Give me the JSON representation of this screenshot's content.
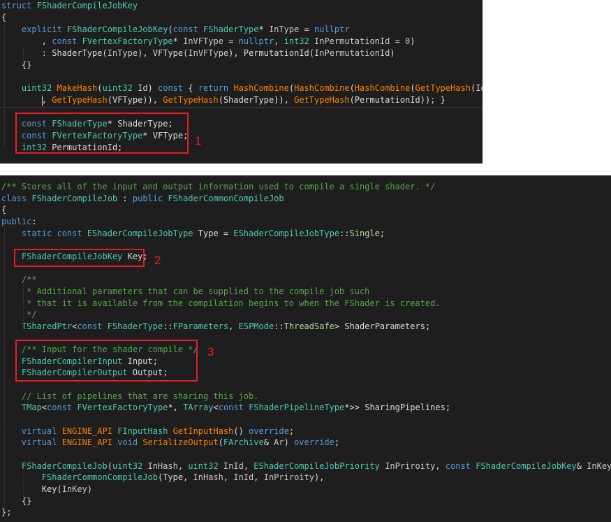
{
  "panel1": {
    "lines": [
      [
        {
          "t": "struct ",
          "c": "kw"
        },
        {
          "t": "FShaderCompileJobKey",
          "c": "ty"
        }
      ],
      [
        {
          "t": "{",
          "c": "pn"
        }
      ],
      [
        {
          "t": "    explicit ",
          "c": "kw"
        },
        {
          "t": "FShaderCompileJobKey",
          "c": "ty"
        },
        {
          "t": "(",
          "c": "pn"
        },
        {
          "t": "const ",
          "c": "kw"
        },
        {
          "t": "FShaderType",
          "c": "ty"
        },
        {
          "t": "* ",
          "c": "pn"
        },
        {
          "t": "InType",
          "c": "pm"
        },
        {
          "t": " = ",
          "c": "pn"
        },
        {
          "t": "nullptr",
          "c": "kw"
        }
      ],
      [
        {
          "t": "        , ",
          "c": "pn"
        },
        {
          "t": "const ",
          "c": "kw"
        },
        {
          "t": "FVertexFactoryType",
          "c": "ty"
        },
        {
          "t": "* ",
          "c": "pn"
        },
        {
          "t": "InVFType",
          "c": "pm"
        },
        {
          "t": " = ",
          "c": "pn"
        },
        {
          "t": "nullptr",
          "c": "kw"
        },
        {
          "t": ", ",
          "c": "pn"
        },
        {
          "t": "int32 ",
          "c": "ty"
        },
        {
          "t": "InPermutationId",
          "c": "pm"
        },
        {
          "t": " = ",
          "c": "pn"
        },
        {
          "t": "0",
          "c": "num"
        },
        {
          "t": ")",
          "c": "pn"
        }
      ],
      [
        {
          "t": "        : ",
          "c": "pn"
        },
        {
          "t": "ShaderType",
          "c": "pn"
        },
        {
          "t": "(",
          "c": "pn"
        },
        {
          "t": "InType",
          "c": "pm"
        },
        {
          "t": "), ",
          "c": "pn"
        },
        {
          "t": "VFType",
          "c": "pn"
        },
        {
          "t": "(",
          "c": "pn"
        },
        {
          "t": "InVFType",
          "c": "pm"
        },
        {
          "t": "), ",
          "c": "pn"
        },
        {
          "t": "PermutationId",
          "c": "pn"
        },
        {
          "t": "(",
          "c": "pn"
        },
        {
          "t": "InPermutationId",
          "c": "pm"
        },
        {
          "t": ")",
          "c": "pn"
        }
      ],
      [
        {
          "t": "    {}",
          "c": "pn"
        }
      ],
      [
        {
          "t": "",
          "c": "pn"
        }
      ],
      [
        {
          "t": "    uint32 ",
          "c": "ty"
        },
        {
          "t": "MakeHash",
          "c": "ft"
        },
        {
          "t": "(",
          "c": "pn"
        },
        {
          "t": "uint32 ",
          "c": "ty"
        },
        {
          "t": "Id",
          "c": "pm"
        },
        {
          "t": ") ",
          "c": "pn"
        },
        {
          "t": "const ",
          "c": "kw"
        },
        {
          "t": "{ ",
          "c": "pn"
        },
        {
          "t": "return ",
          "c": "kw"
        },
        {
          "t": "HashCombine",
          "c": "ft"
        },
        {
          "t": "(",
          "c": "pn"
        },
        {
          "t": "HashCombine",
          "c": "ft"
        },
        {
          "t": "(",
          "c": "pn"
        },
        {
          "t": "HashCombine",
          "c": "ft"
        },
        {
          "t": "(",
          "c": "pn"
        },
        {
          "t": "GetTypeHash",
          "c": "ft"
        },
        {
          "t": "(",
          "c": "pn"
        },
        {
          "t": "Id",
          "c": "pm"
        },
        {
          "t": ")",
          "c": "pn"
        }
      ],
      [
        {
          "t": "        , ",
          "c": "pn"
        },
        {
          "t": "GetTypeHash",
          "c": "ft"
        },
        {
          "t": "(",
          "c": "pn"
        },
        {
          "t": "VFType",
          "c": "pn"
        },
        {
          "t": ")), ",
          "c": "pn"
        },
        {
          "t": "GetTypeHash",
          "c": "ft"
        },
        {
          "t": "(",
          "c": "pn"
        },
        {
          "t": "ShaderType",
          "c": "pn"
        },
        {
          "t": ")), ",
          "c": "pn"
        },
        {
          "t": "GetTypeHash",
          "c": "ft"
        },
        {
          "t": "(",
          "c": "pn"
        },
        {
          "t": "PermutationId",
          "c": "pn"
        },
        {
          "t": ")); }",
          "c": "pn"
        }
      ],
      [
        {
          "t": "",
          "c": "pn"
        }
      ],
      [
        {
          "t": "    const ",
          "c": "kw"
        },
        {
          "t": "FShaderType",
          "c": "ty"
        },
        {
          "t": "* ",
          "c": "pn"
        },
        {
          "t": "ShaderType;",
          "c": "pn"
        }
      ],
      [
        {
          "t": "    const ",
          "c": "kw"
        },
        {
          "t": "FVertexFactoryType",
          "c": "ty"
        },
        {
          "t": "* ",
          "c": "pn"
        },
        {
          "t": "VFType;",
          "c": "pn"
        }
      ],
      [
        {
          "t": "    int32 ",
          "c": "ty"
        },
        {
          "t": "PermutationId;",
          "c": "pn"
        }
      ]
    ],
    "callout": "1"
  },
  "panel2": {
    "lines": [
      [
        {
          "t": "/** Stores all of the input and output information used to compile a single shader. */",
          "c": "cm"
        }
      ],
      [
        {
          "t": "class ",
          "c": "kw"
        },
        {
          "t": "FShaderCompileJob",
          "c": "ty"
        },
        {
          "t": " : ",
          "c": "pn"
        },
        {
          "t": "public ",
          "c": "kw"
        },
        {
          "t": "FShaderCommonCompileJob",
          "c": "ty"
        }
      ],
      [
        {
          "t": "{",
          "c": "pn"
        }
      ],
      [
        {
          "t": "public",
          "c": "kw"
        },
        {
          "t": ":",
          "c": "pn"
        }
      ],
      [
        {
          "t": "    static const ",
          "c": "kw"
        },
        {
          "t": "EShaderCompileJobType",
          "c": "ty"
        },
        {
          "t": " Type = ",
          "c": "pn"
        },
        {
          "t": "EShaderCompileJobType",
          "c": "ty"
        },
        {
          "t": "::",
          "c": "pn"
        },
        {
          "t": "Single",
          "c": "en"
        },
        {
          "t": ";",
          "c": "pn"
        }
      ],
      [
        {
          "t": "",
          "c": "pn"
        }
      ],
      [
        {
          "t": "    ",
          "c": "pn"
        },
        {
          "t": "FShaderCompileJobKey",
          "c": "ty"
        },
        {
          "t": " Key;",
          "c": "pn"
        }
      ],
      [
        {
          "t": "",
          "c": "pn"
        }
      ],
      [
        {
          "t": "    /**",
          "c": "cm"
        }
      ],
      [
        {
          "t": "     * Additional parameters that can be supplied to the compile job such",
          "c": "cm"
        }
      ],
      [
        {
          "t": "     * that it is available from the compilation begins to when the FShader is created.",
          "c": "cm"
        }
      ],
      [
        {
          "t": "     */",
          "c": "cm"
        }
      ],
      [
        {
          "t": "    TSharedPtr",
          "c": "ty"
        },
        {
          "t": "<",
          "c": "pn"
        },
        {
          "t": "const ",
          "c": "kw"
        },
        {
          "t": "FShaderType",
          "c": "ty"
        },
        {
          "t": "::",
          "c": "pn"
        },
        {
          "t": "FParameters",
          "c": "ty"
        },
        {
          "t": ", ",
          "c": "pn"
        },
        {
          "t": "ESPMode",
          "c": "ty"
        },
        {
          "t": "::",
          "c": "pn"
        },
        {
          "t": "ThreadSafe",
          "c": "en"
        },
        {
          "t": "> ShaderParameters;",
          "c": "pn"
        }
      ],
      [
        {
          "t": "",
          "c": "pn"
        }
      ],
      [
        {
          "t": "    /** Input for the shader compile */",
          "c": "cm"
        }
      ],
      [
        {
          "t": "    FShaderCompilerInput",
          "c": "ty"
        },
        {
          "t": " Input;",
          "c": "pn"
        }
      ],
      [
        {
          "t": "    FShaderCompilerOutput",
          "c": "ty"
        },
        {
          "t": " Output;",
          "c": "pn"
        }
      ],
      [
        {
          "t": "",
          "c": "pn"
        }
      ],
      [
        {
          "t": "    // List of pipelines that are sharing this job.",
          "c": "cm"
        }
      ],
      [
        {
          "t": "    TMap",
          "c": "ty"
        },
        {
          "t": "<",
          "c": "pn"
        },
        {
          "t": "const ",
          "c": "kw"
        },
        {
          "t": "FVertexFactoryType",
          "c": "ty"
        },
        {
          "t": "*, ",
          "c": "pn"
        },
        {
          "t": "TArray",
          "c": "ty"
        },
        {
          "t": "<",
          "c": "pn"
        },
        {
          "t": "const ",
          "c": "kw"
        },
        {
          "t": "FShaderPipelineType",
          "c": "ty"
        },
        {
          "t": "*>> SharingPipelines;",
          "c": "pn"
        }
      ],
      [
        {
          "t": "",
          "c": "pn"
        }
      ],
      [
        {
          "t": "    virtual ",
          "c": "kw"
        },
        {
          "t": "ENGINE_API ",
          "c": "ft"
        },
        {
          "t": "FInputHash",
          "c": "ty"
        },
        {
          "t": " ",
          "c": "pn"
        },
        {
          "t": "GetInputHash",
          "c": "ft"
        },
        {
          "t": "() ",
          "c": "pn"
        },
        {
          "t": "override",
          "c": "kw"
        },
        {
          "t": ";",
          "c": "pn"
        }
      ],
      [
        {
          "t": "    virtual ",
          "c": "kw"
        },
        {
          "t": "ENGINE_API ",
          "c": "ft"
        },
        {
          "t": "void ",
          "c": "kw"
        },
        {
          "t": "SerializeOutput",
          "c": "ft"
        },
        {
          "t": "(",
          "c": "pn"
        },
        {
          "t": "FArchive",
          "c": "ty"
        },
        {
          "t": "& ",
          "c": "pn"
        },
        {
          "t": "Ar",
          "c": "pm"
        },
        {
          "t": ") ",
          "c": "pn"
        },
        {
          "t": "override",
          "c": "kw"
        },
        {
          "t": ";",
          "c": "pn"
        }
      ],
      [
        {
          "t": "",
          "c": "pn"
        }
      ],
      [
        {
          "t": "    FShaderCompileJob",
          "c": "ty"
        },
        {
          "t": "(",
          "c": "pn"
        },
        {
          "t": "uint32 ",
          "c": "ty"
        },
        {
          "t": "InHash",
          "c": "pm"
        },
        {
          "t": ", ",
          "c": "pn"
        },
        {
          "t": "uint32 ",
          "c": "ty"
        },
        {
          "t": "InId",
          "c": "pm"
        },
        {
          "t": ", ",
          "c": "pn"
        },
        {
          "t": "EShaderCompileJobPriority",
          "c": "ty"
        },
        {
          "t": " ",
          "c": "pn"
        },
        {
          "t": "InPriroity",
          "c": "pm"
        },
        {
          "t": ", ",
          "c": "pn"
        },
        {
          "t": "const ",
          "c": "kw"
        },
        {
          "t": "FShaderCompileJobKey",
          "c": "ty"
        },
        {
          "t": "& ",
          "c": "pn"
        },
        {
          "t": "InKey",
          "c": "pm"
        },
        {
          "t": ") :",
          "c": "pn"
        }
      ],
      [
        {
          "t": "        ",
          "c": "pn"
        },
        {
          "t": "FShaderCommonCompileJob",
          "c": "ty"
        },
        {
          "t": "(Type, ",
          "c": "pn"
        },
        {
          "t": "InHash",
          "c": "pm"
        },
        {
          "t": ", ",
          "c": "pn"
        },
        {
          "t": "InId",
          "c": "pm"
        },
        {
          "t": ", ",
          "c": "pn"
        },
        {
          "t": "InPriroity",
          "c": "pm"
        },
        {
          "t": "),",
          "c": "pn"
        }
      ],
      [
        {
          "t": "        Key(",
          "c": "pn"
        },
        {
          "t": "InKey",
          "c": "pm"
        },
        {
          "t": ")",
          "c": "pn"
        }
      ],
      [
        {
          "t": "    {}",
          "c": "pn"
        }
      ],
      [
        {
          "t": "};",
          "c": "pn"
        }
      ]
    ],
    "callout_2": "2",
    "callout_3": "3"
  }
}
